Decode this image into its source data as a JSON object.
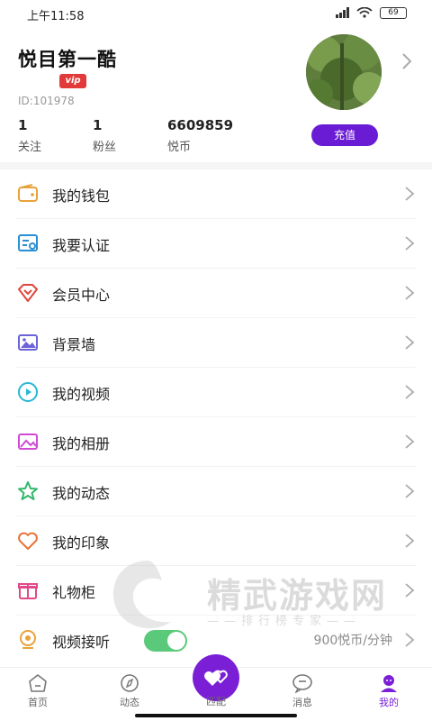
{
  "status_bar": {
    "time": "上午11:58",
    "battery": "69"
  },
  "profile": {
    "nickname": "悦目第一酷",
    "vip_badge": "vip",
    "id_text": "ID:101978",
    "stats": [
      {
        "value": "1",
        "label": "关注"
      },
      {
        "value": "1",
        "label": "粉丝"
      },
      {
        "value": "6609859",
        "label": "悦币"
      }
    ],
    "recharge_label": "充值"
  },
  "menu": [
    {
      "label": "我的钱包",
      "icon": "wallet-icon",
      "color": "#e8a23a"
    },
    {
      "label": "我要认证",
      "icon": "certification-icon",
      "color": "#2a8fd4"
    },
    {
      "label": "会员中心",
      "icon": "diamond-icon",
      "color": "#e0463a"
    },
    {
      "label": "背景墙",
      "icon": "image-wall-icon",
      "color": "#6b63d8"
    },
    {
      "label": "我的视频",
      "icon": "video-icon",
      "color": "#27b8d6"
    },
    {
      "label": "我的相册",
      "icon": "album-icon",
      "color": "#d04ad6"
    },
    {
      "label": "我的动态",
      "icon": "star-icon",
      "color": "#32b86a"
    },
    {
      "label": "我的印象",
      "icon": "heart-icon",
      "color": "#e8733a"
    },
    {
      "label": "礼物柜",
      "icon": "gift-icon",
      "color": "#e04a8a"
    },
    {
      "label": "视频接听",
      "icon": "camera-icon",
      "color": "#e8a23a",
      "right_text": "900悦币/分钟",
      "toggle_on": true
    }
  ],
  "watermark": {
    "title": "精武游戏网",
    "subtitle": "——排行榜专家——"
  },
  "tabs": [
    {
      "label": "首页",
      "icon": "home-icon"
    },
    {
      "label": "动态",
      "icon": "compass-icon"
    },
    {
      "label": "匹配",
      "icon": "match-heart-icon"
    },
    {
      "label": "消息",
      "icon": "message-icon"
    },
    {
      "label": "我的",
      "icon": "profile-icon",
      "active": true
    }
  ],
  "colors": {
    "accent": "#7a1fd6",
    "recharge": "#6a1cd4",
    "vip": "#e23a3a",
    "toggle": "#5bc97a"
  }
}
